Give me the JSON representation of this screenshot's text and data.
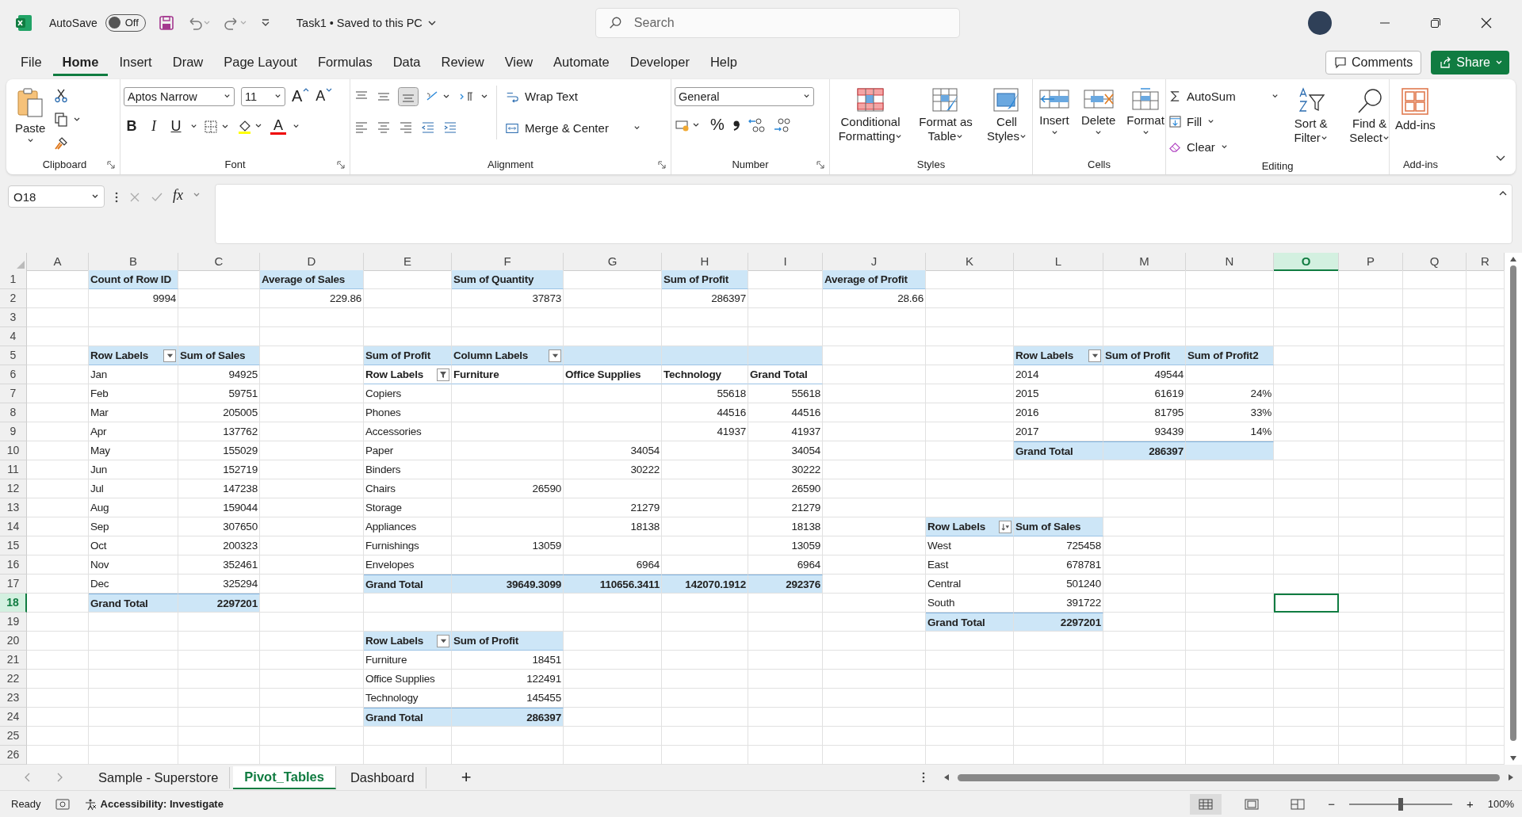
{
  "title_bar": {
    "autosave": {
      "label": "AutoSave",
      "state": "Off",
      "on": false
    },
    "document": "Task1 • Saved to this PC",
    "search": {
      "placeholder": "Search"
    }
  },
  "tabs": [
    {
      "label": "File",
      "selected": false
    },
    {
      "label": "Home",
      "selected": true
    },
    {
      "label": "Insert",
      "selected": false
    },
    {
      "label": "Draw",
      "selected": false
    },
    {
      "label": "Page Layout",
      "selected": false
    },
    {
      "label": "Formulas",
      "selected": false
    },
    {
      "label": "Data",
      "selected": false
    },
    {
      "label": "Review",
      "selected": false
    },
    {
      "label": "View",
      "selected": false
    },
    {
      "label": "Automate",
      "selected": false
    },
    {
      "label": "Developer",
      "selected": false
    },
    {
      "label": "Help",
      "selected": false
    }
  ],
  "actions": {
    "comments": "Comments",
    "share": "Share"
  },
  "ribbon": {
    "clipboard": {
      "paste": "Paste",
      "label": "Clipboard"
    },
    "font": {
      "family": "Aptos Narrow",
      "size": "11",
      "grow": "A",
      "shrink": "A",
      "bold": "B",
      "italic": "I",
      "underline": "U",
      "font_color": "A",
      "label": "Font"
    },
    "alignment": {
      "wrap": "Wrap Text",
      "merge": "Merge & Center",
      "label": "Alignment"
    },
    "number": {
      "format": "General",
      "percent": "%",
      "label": "Number"
    },
    "styles": {
      "items": [
        "Conditional Formatting",
        "Format as Table",
        "Cell Styles"
      ],
      "label": "Styles"
    },
    "cells": {
      "items": [
        "Insert",
        "Delete",
        "Format"
      ],
      "label": "Cells"
    },
    "editing": {
      "autosum": "AutoSum",
      "fill": "Fill",
      "clear": "Clear",
      "sort": "Sort & Filter",
      "find": "Find & Select",
      "label": "Editing"
    },
    "addins": {
      "button": "Add-ins",
      "label": "Add-ins"
    }
  },
  "formula_bar": {
    "name_box": "O18",
    "fx": "fx"
  },
  "sheet": {
    "columns": [
      {
        "label": "A",
        "selected": false
      },
      {
        "label": "B",
        "selected": false
      },
      {
        "label": "C",
        "selected": false
      },
      {
        "label": "D",
        "selected": false
      },
      {
        "label": "E",
        "selected": false
      },
      {
        "label": "F",
        "selected": false
      },
      {
        "label": "G",
        "selected": false
      },
      {
        "label": "H",
        "selected": false
      },
      {
        "label": "I",
        "selected": false
      },
      {
        "label": "J",
        "selected": false
      },
      {
        "label": "K",
        "selected": false
      },
      {
        "label": "L",
        "selected": false
      },
      {
        "label": "M",
        "selected": false
      },
      {
        "label": "N",
        "selected": false
      },
      {
        "label": "O",
        "selected": true
      },
      {
        "label": "P",
        "selected": false
      },
      {
        "label": "Q",
        "selected": false
      },
      {
        "label": "R",
        "selected": false
      }
    ],
    "rows": [
      {
        "number": "1",
        "selected": false,
        "cells": [
          {
            "text": ""
          },
          {
            "text": "Count of Row ID",
            "kind": "header"
          },
          {
            "text": ""
          },
          {
            "text": "Average of Sales",
            "kind": "header"
          },
          {
            "text": ""
          },
          {
            "text": "Sum of Quantity",
            "kind": "header"
          },
          {
            "text": ""
          },
          {
            "text": "Sum of Profit",
            "kind": "header"
          },
          {
            "text": ""
          },
          {
            "text": "Average of Profit",
            "kind": "header"
          }
        ]
      },
      {
        "number": "2",
        "selected": false,
        "cells": [
          {
            "text": ""
          },
          {
            "text": "9994",
            "kind": "value"
          },
          {
            "text": ""
          },
          {
            "text": "229.86",
            "kind": "value"
          },
          {
            "text": ""
          },
          {
            "text": "37873",
            "kind": "value"
          },
          {
            "text": ""
          },
          {
            "text": "286397",
            "kind": "value"
          },
          {
            "text": ""
          },
          {
            "text": "28.66",
            "kind": "value"
          }
        ]
      },
      {
        "number": "3",
        "selected": false,
        "cells": []
      },
      {
        "number": "4",
        "selected": false,
        "cells": []
      },
      {
        "number": "5",
        "selected": false,
        "cells": [
          {
            "text": ""
          },
          {
            "text": "Row Labels",
            "kind": "header",
            "dropdown": true
          },
          {
            "text": "Sum of Sales",
            "kind": "header"
          },
          {
            "text": ""
          },
          {
            "text": "Sum of Profit",
            "kind": "header"
          },
          {
            "text": "Column Labels",
            "kind": "header",
            "dropdown": true
          },
          {
            "text": "",
            "kind": "header"
          },
          {
            "text": "",
            "kind": "header"
          },
          {
            "text": "",
            "kind": "header"
          },
          {
            "text": ""
          },
          {
            "text": ""
          },
          {
            "text": "Row Labels",
            "kind": "header",
            "dropdown": true
          },
          {
            "text": "Sum of Profit",
            "kind": "header"
          },
          {
            "text": "Sum of Profit2",
            "kind": "header"
          }
        ]
      },
      {
        "number": "6",
        "selected": false,
        "cells": [
          {
            "text": ""
          },
          {
            "text": "Jan",
            "kind": "label"
          },
          {
            "text": "94925",
            "kind": "value"
          },
          {
            "text": ""
          },
          {
            "text": "Row Labels",
            "kind": "column-head",
            "dropdown": true,
            "filtered": true
          },
          {
            "text": "Furniture",
            "kind": "column-head"
          },
          {
            "text": "Office Supplies",
            "kind": "column-head"
          },
          {
            "text": "Technology",
            "kind": "column-head"
          },
          {
            "text": "Grand Total",
            "kind": "column-head"
          },
          {
            "text": ""
          },
          {
            "text": ""
          },
          {
            "text": "2014",
            "kind": "label"
          },
          {
            "text": "49544",
            "kind": "value"
          }
        ]
      },
      {
        "number": "7",
        "selected": false,
        "cells": [
          {
            "text": ""
          },
          {
            "text": "Feb",
            "kind": "label"
          },
          {
            "text": "59751",
            "kind": "value"
          },
          {
            "text": ""
          },
          {
            "text": "Copiers",
            "kind": "label"
          },
          {
            "text": ""
          },
          {
            "text": ""
          },
          {
            "text": "55618",
            "kind": "value"
          },
          {
            "text": "55618",
            "kind": "value"
          },
          {
            "text": ""
          },
          {
            "text": ""
          },
          {
            "text": "2015",
            "kind": "label"
          },
          {
            "text": "61619",
            "kind": "value"
          },
          {
            "text": "24%",
            "kind": "value"
          }
        ]
      },
      {
        "number": "8",
        "selected": false,
        "cells": [
          {
            "text": ""
          },
          {
            "text": "Mar",
            "kind": "label"
          },
          {
            "text": "205005",
            "kind": "value"
          },
          {
            "text": ""
          },
          {
            "text": "Phones",
            "kind": "label"
          },
          {
            "text": ""
          },
          {
            "text": ""
          },
          {
            "text": "44516",
            "kind": "value"
          },
          {
            "text": "44516",
            "kind": "value"
          },
          {
            "text": ""
          },
          {
            "text": ""
          },
          {
            "text": "2016",
            "kind": "label"
          },
          {
            "text": "81795",
            "kind": "value"
          },
          {
            "text": "33%",
            "kind": "value"
          }
        ]
      },
      {
        "number": "9",
        "selected": false,
        "cells": [
          {
            "text": ""
          },
          {
            "text": "Apr",
            "kind": "label"
          },
          {
            "text": "137762",
            "kind": "value"
          },
          {
            "text": ""
          },
          {
            "text": "Accessories",
            "kind": "label"
          },
          {
            "text": ""
          },
          {
            "text": ""
          },
          {
            "text": "41937",
            "kind": "value"
          },
          {
            "text": "41937",
            "kind": "value"
          },
          {
            "text": ""
          },
          {
            "text": ""
          },
          {
            "text": "2017",
            "kind": "label"
          },
          {
            "text": "93439",
            "kind": "value"
          },
          {
            "text": "14%",
            "kind": "value"
          }
        ]
      },
      {
        "number": "10",
        "selected": false,
        "cells": [
          {
            "text": ""
          },
          {
            "text": "May",
            "kind": "label"
          },
          {
            "text": "155029",
            "kind": "value"
          },
          {
            "text": ""
          },
          {
            "text": "Paper",
            "kind": "label"
          },
          {
            "text": ""
          },
          {
            "text": "34054",
            "kind": "value"
          },
          {
            "text": ""
          },
          {
            "text": "34054",
            "kind": "value"
          },
          {
            "text": ""
          },
          {
            "text": ""
          },
          {
            "text": "Grand Total",
            "kind": "total-label"
          },
          {
            "text": "286397",
            "kind": "total-value"
          },
          {
            "text": "",
            "kind": "total-value"
          }
        ]
      },
      {
        "number": "11",
        "selected": false,
        "cells": [
          {
            "text": ""
          },
          {
            "text": "Jun",
            "kind": "label"
          },
          {
            "text": "152719",
            "kind": "value"
          },
          {
            "text": ""
          },
          {
            "text": "Binders",
            "kind": "label"
          },
          {
            "text": ""
          },
          {
            "text": "30222",
            "kind": "value"
          },
          {
            "text": ""
          },
          {
            "text": "30222",
            "kind": "value"
          }
        ]
      },
      {
        "number": "12",
        "selected": false,
        "cells": [
          {
            "text": ""
          },
          {
            "text": "Jul",
            "kind": "label"
          },
          {
            "text": "147238",
            "kind": "value"
          },
          {
            "text": ""
          },
          {
            "text": "Chairs",
            "kind": "label"
          },
          {
            "text": "26590",
            "kind": "value"
          },
          {
            "text": ""
          },
          {
            "text": ""
          },
          {
            "text": "26590",
            "kind": "value"
          }
        ]
      },
      {
        "number": "13",
        "selected": false,
        "cells": [
          {
            "text": ""
          },
          {
            "text": "Aug",
            "kind": "label"
          },
          {
            "text": "159044",
            "kind": "value"
          },
          {
            "text": ""
          },
          {
            "text": "Storage",
            "kind": "label"
          },
          {
            "text": ""
          },
          {
            "text": "21279",
            "kind": "value"
          },
          {
            "text": ""
          },
          {
            "text": "21279",
            "kind": "value"
          }
        ]
      },
      {
        "number": "14",
        "selected": false,
        "cells": [
          {
            "text": ""
          },
          {
            "text": "Sep",
            "kind": "label"
          },
          {
            "text": "307650",
            "kind": "value"
          },
          {
            "text": ""
          },
          {
            "text": "Appliances",
            "kind": "label"
          },
          {
            "text": ""
          },
          {
            "text": "18138",
            "kind": "value"
          },
          {
            "text": ""
          },
          {
            "text": "18138",
            "kind": "value"
          },
          {
            "text": ""
          },
          {
            "text": "Row Labels",
            "kind": "header",
            "dropdown": true,
            "sorted": true
          },
          {
            "text": "Sum of Sales",
            "kind": "header"
          }
        ]
      },
      {
        "number": "15",
        "selected": false,
        "cells": [
          {
            "text": ""
          },
          {
            "text": "Oct",
            "kind": "label"
          },
          {
            "text": "200323",
            "kind": "value"
          },
          {
            "text": ""
          },
          {
            "text": "Furnishings",
            "kind": "label"
          },
          {
            "text": "13059",
            "kind": "value"
          },
          {
            "text": ""
          },
          {
            "text": ""
          },
          {
            "text": "13059",
            "kind": "value"
          },
          {
            "text": ""
          },
          {
            "text": "West",
            "kind": "label"
          },
          {
            "text": "725458",
            "kind": "value"
          }
        ]
      },
      {
        "number": "16",
        "selected": false,
        "cells": [
          {
            "text": ""
          },
          {
            "text": "Nov",
            "kind": "label"
          },
          {
            "text": "352461",
            "kind": "value"
          },
          {
            "text": ""
          },
          {
            "text": "Envelopes",
            "kind": "label"
          },
          {
            "text": ""
          },
          {
            "text": "6964",
            "kind": "value"
          },
          {
            "text": ""
          },
          {
            "text": "6964",
            "kind": "value"
          },
          {
            "text": ""
          },
          {
            "text": "East",
            "kind": "label"
          },
          {
            "text": "678781",
            "kind": "value"
          }
        ]
      },
      {
        "number": "17",
        "selected": false,
        "cells": [
          {
            "text": ""
          },
          {
            "text": "Dec",
            "kind": "label"
          },
          {
            "text": "325294",
            "kind": "value"
          },
          {
            "text": ""
          },
          {
            "text": "Grand Total",
            "kind": "total-label"
          },
          {
            "text": "39649.3099",
            "kind": "total-value"
          },
          {
            "text": "110656.3411",
            "kind": "total-value"
          },
          {
            "text": "142070.1912",
            "kind": "total-value"
          },
          {
            "text": "292376",
            "kind": "total-value"
          },
          {
            "text": ""
          },
          {
            "text": "Central",
            "kind": "label"
          },
          {
            "text": "501240",
            "kind": "value"
          }
        ]
      },
      {
        "number": "18",
        "selected": true,
        "cells": [
          {
            "text": ""
          },
          {
            "text": "Grand Total",
            "kind": "total-label"
          },
          {
            "text": "2297201",
            "kind": "total-value"
          },
          {
            "text": ""
          },
          {
            "text": ""
          },
          {
            "text": ""
          },
          {
            "text": ""
          },
          {
            "text": ""
          },
          {
            "text": ""
          },
          {
            "text": ""
          },
          {
            "text": "South",
            "kind": "label"
          },
          {
            "text": "391722",
            "kind": "value"
          }
        ]
      },
      {
        "number": "19",
        "selected": false,
        "cells": [
          {
            "text": ""
          },
          {
            "text": ""
          },
          {
            "text": ""
          },
          {
            "text": ""
          },
          {
            "text": ""
          },
          {
            "text": ""
          },
          {
            "text": ""
          },
          {
            "text": ""
          },
          {
            "text": ""
          },
          {
            "text": ""
          },
          {
            "text": "Grand Total",
            "kind": "total-label"
          },
          {
            "text": "2297201",
            "kind": "total-value"
          }
        ]
      },
      {
        "number": "20",
        "selected": false,
        "cells": [
          {
            "text": ""
          },
          {
            "text": ""
          },
          {
            "text": ""
          },
          {
            "text": ""
          },
          {
            "text": "Row Labels",
            "kind": "header",
            "dropdown": true
          },
          {
            "text": "Sum of Profit",
            "kind": "header"
          }
        ]
      },
      {
        "number": "21",
        "selected": false,
        "cells": [
          {
            "text": ""
          },
          {
            "text": ""
          },
          {
            "text": ""
          },
          {
            "text": ""
          },
          {
            "text": "Furniture",
            "kind": "label"
          },
          {
            "text": "18451",
            "kind": "value"
          }
        ]
      },
      {
        "number": "22",
        "selected": false,
        "cells": [
          {
            "text": ""
          },
          {
            "text": ""
          },
          {
            "text": ""
          },
          {
            "text": ""
          },
          {
            "text": "Office Supplies",
            "kind": "label"
          },
          {
            "text": "122491",
            "kind": "value"
          }
        ]
      },
      {
        "number": "23",
        "selected": false,
        "cells": [
          {
            "text": ""
          },
          {
            "text": ""
          },
          {
            "text": ""
          },
          {
            "text": ""
          },
          {
            "text": "Technology",
            "kind": "label"
          },
          {
            "text": "145455",
            "kind": "value"
          }
        ]
      },
      {
        "number": "24",
        "selected": false,
        "cells": [
          {
            "text": ""
          },
          {
            "text": ""
          },
          {
            "text": ""
          },
          {
            "text": ""
          },
          {
            "text": "Grand Total",
            "kind": "total-label"
          },
          {
            "text": "286397",
            "kind": "total-value"
          }
        ]
      },
      {
        "number": "25",
        "selected": false,
        "cells": []
      },
      {
        "number": "26",
        "selected": false,
        "cells": []
      }
    ]
  },
  "sheet_tabs": {
    "tabs": [
      {
        "label": "Sample - Superstore",
        "selected": false
      },
      {
        "label": "Pivot_Tables",
        "selected": true
      },
      {
        "label": "Dashboard",
        "selected": false
      }
    ],
    "add": "+"
  },
  "status_bar": {
    "mode": "Ready",
    "accessibility": "Accessibility: Investigate",
    "views": [
      {
        "kind": "normal",
        "selected": true
      },
      {
        "kind": "page-layout",
        "selected": false
      },
      {
        "kind": "page-break",
        "selected": false
      }
    ],
    "zoom_out": "−",
    "zoom_in": "+",
    "zoom": {
      "level": 0.5
    },
    "zoom_text": "100%"
  }
}
